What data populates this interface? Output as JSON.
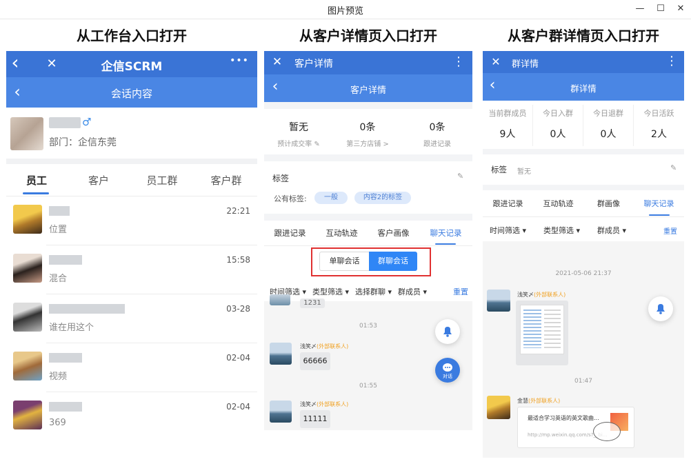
{
  "window": {
    "title": "图片预览",
    "minimize": "—",
    "maximize": "☐",
    "close": "✕"
  },
  "headings": [
    "从工作台入口打开",
    "从客户详情页入口打开",
    "从客户群详情页入口打开"
  ],
  "panel1": {
    "app_title": "企信SCRM",
    "back": "‹",
    "close": "✕",
    "more": "•••",
    "sub_title": "会话内容",
    "sub_back": "‹",
    "profile": {
      "gender": "♂",
      "dept": "部门：企信东莞"
    },
    "tabs": [
      "员工",
      "客户",
      "员工群",
      "客户群"
    ],
    "active_tab": 0,
    "items": [
      {
        "preview": "位置",
        "time": "22:21"
      },
      {
        "preview": "混合",
        "time": "15:58"
      },
      {
        "preview": "谁在用这个",
        "time": "03-28"
      },
      {
        "preview": "视频",
        "time": "02-04"
      },
      {
        "preview": "369",
        "time": "02-04"
      }
    ]
  },
  "panel2": {
    "top_title": "客户详情",
    "close": "✕",
    "more": "⋮",
    "sub_title": "客户详情",
    "sub_back": "‹",
    "stats": [
      {
        "value": "暂无",
        "label": "预计成交率 ✎"
      },
      {
        "value": "0条",
        "label": "第三方店铺 >"
      },
      {
        "value": "0条",
        "label": "跟进记录"
      }
    ],
    "tag_section": "标签",
    "edit": "✎",
    "public_tags_label": "公有标签:",
    "tags": [
      "一般",
      "内容2的标签"
    ],
    "tabs": [
      "跟进记录",
      "互动轨迹",
      "客户画像",
      "聊天记录"
    ],
    "active_tab": 3,
    "toggle": [
      "单聊会话",
      "群聊会话"
    ],
    "filters": [
      "时间筛选",
      "类型筛选",
      "选择群聊",
      "群成员"
    ],
    "reset": "重置",
    "partial_msg": "1231",
    "times": [
      "01:53",
      "01:55"
    ],
    "sender": "浅笑〆",
    "sender_tag": "(外部联系人)",
    "messages": [
      "66666",
      "11111"
    ],
    "chat_label": "对话"
  },
  "panel3": {
    "top_title": "群详情",
    "close": "✕",
    "more": "⋮",
    "sub_title": "群详情",
    "sub_back": "‹",
    "stats": [
      {
        "label": "当前群成员",
        "value": "9人"
      },
      {
        "label": "今日入群",
        "value": "0人"
      },
      {
        "label": "今日退群",
        "value": "0人"
      },
      {
        "label": "今日活跃",
        "value": "2人"
      }
    ],
    "tag_label": "标签",
    "tag_value": "暂无",
    "edit": "✎",
    "tabs": [
      "跟进记录",
      "互动轨迹",
      "群画像",
      "聊天记录"
    ],
    "active_tab": 3,
    "filters": [
      "时间筛选",
      "类型筛选",
      "群成员"
    ],
    "reset": "重置",
    "date": "2021-05-06 21:37",
    "sender1": "浅笑〆",
    "sender1_tag": "(外部联系人)",
    "time2": "01:47",
    "sender2": "金慧",
    "sender2_tag": "(外部联系人)",
    "link_title": "最适合学习英语的英文歌曲...",
    "link_url": "http://mp.weixin.qq.com/s?__bi..."
  },
  "colors": {
    "primary": "#3a74d6",
    "accent": "#3a7be0",
    "orange": "#f0a020",
    "highlight_border": "#e03030"
  }
}
